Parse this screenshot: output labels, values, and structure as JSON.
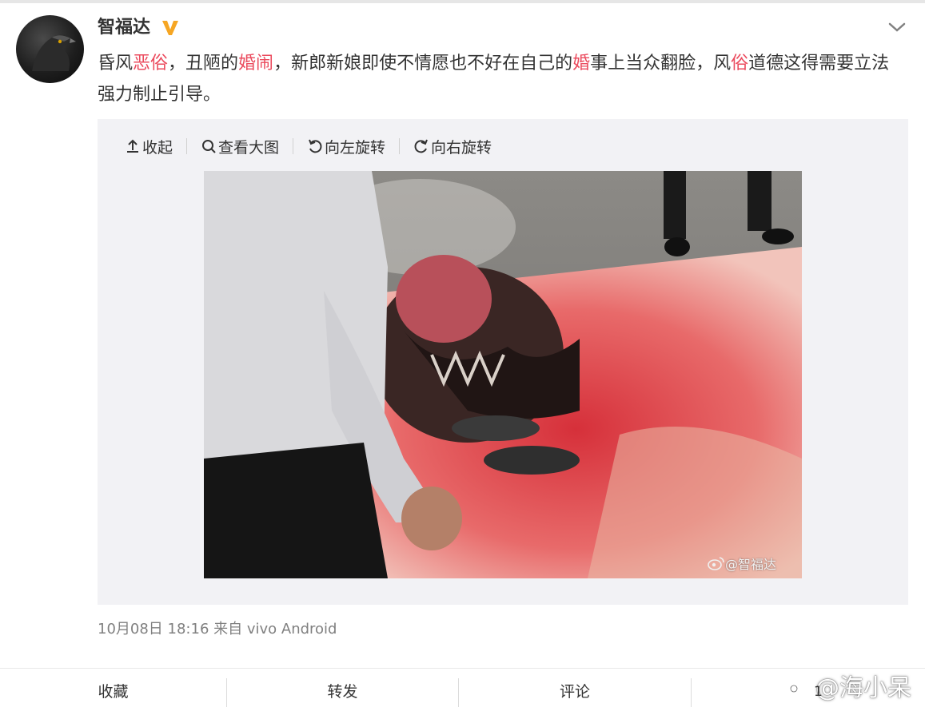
{
  "post": {
    "author": "智福达",
    "verified_icon": "verified-v-icon",
    "text_segments": [
      {
        "text": "昏风",
        "highlight": false
      },
      {
        "text": "恶俗",
        "highlight": true
      },
      {
        "text": "，丑陋的",
        "highlight": false
      },
      {
        "text": "婚闹",
        "highlight": true
      },
      {
        "text": "，新郎新娘即使不情愿也不好在自己的",
        "highlight": false
      },
      {
        "text": "婚",
        "highlight": true
      },
      {
        "text": "事上当众翻脸，风",
        "highlight": false
      },
      {
        "text": "俗",
        "highlight": true
      },
      {
        "text": "道德这得需要立法强力制止引导。",
        "highlight": false
      }
    ],
    "highlight_color": "#eb4b5e",
    "meta": "10月08日 18:16 来自 vivo Android"
  },
  "toolbar": {
    "collapse": "收起",
    "view_large": "查看大图",
    "rotate_left": "向左旋转",
    "rotate_right": "向右旋转"
  },
  "photo": {
    "watermark": "@智福达"
  },
  "footer": {
    "favorite": "收藏",
    "repost": "转发",
    "comment": "评论",
    "like_count": "1"
  },
  "corner_watermark": "@海小呆"
}
